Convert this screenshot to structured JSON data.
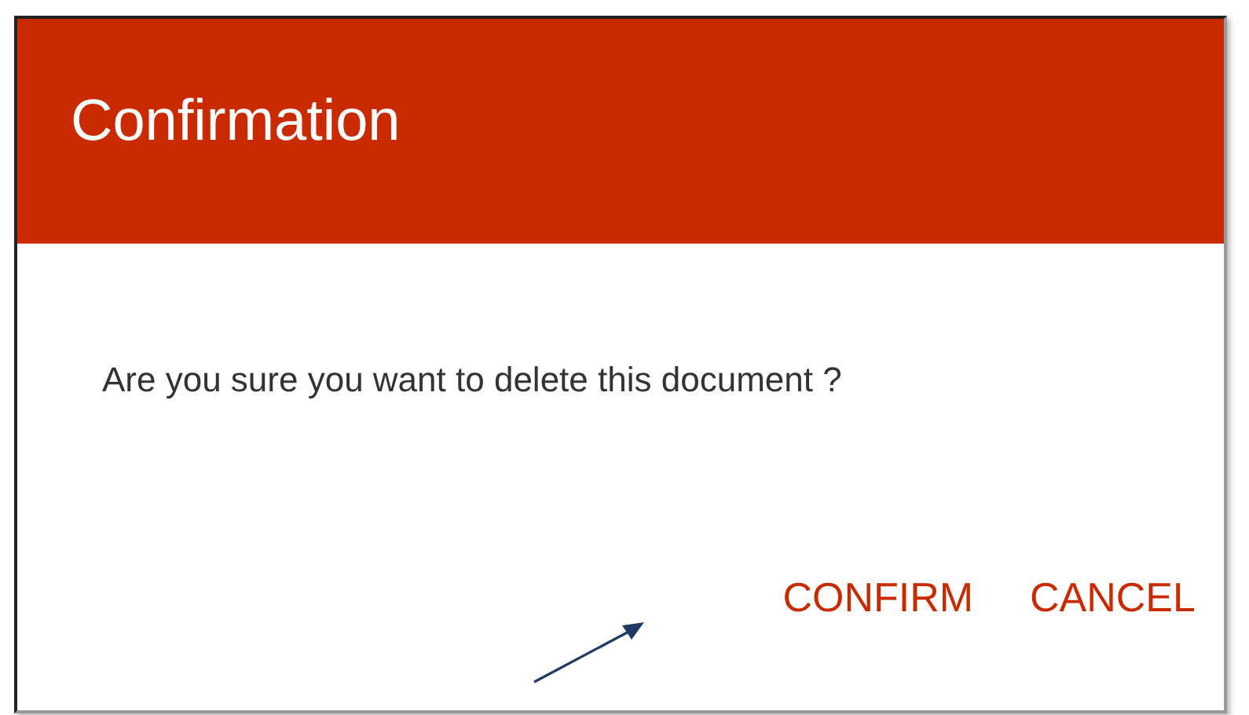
{
  "dialog": {
    "title": "Confirmation",
    "message": "Are you sure you want to delete this document ?",
    "buttons": [
      {
        "label": "CONFIRM"
      },
      {
        "label": "CANCEL"
      }
    ]
  }
}
